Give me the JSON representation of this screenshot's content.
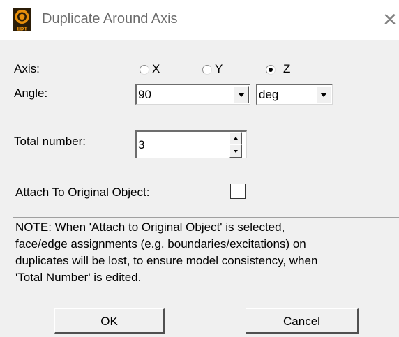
{
  "window": {
    "title": "Duplicate Around Axis",
    "close_glyph": "✕"
  },
  "axis": {
    "label": "Axis:",
    "options": [
      {
        "label": "X",
        "selected": false
      },
      {
        "label": "Y",
        "selected": false
      },
      {
        "label": "Z",
        "selected": true
      }
    ]
  },
  "angle": {
    "label": "Angle:",
    "value": "90",
    "unit": "deg"
  },
  "total_number": {
    "label": "Total number:",
    "value": "3"
  },
  "attach": {
    "label": "Attach To Original Object:",
    "checked": false
  },
  "note": {
    "lines": [
      "NOTE:  When 'Attach to Original Object' is selected,",
      "face/edge assignments (e.g. boundaries/excitations) on",
      "duplicates will be lost, to ensure model consistency, when",
      "'Total Number' is edited."
    ]
  },
  "buttons": {
    "ok": "OK",
    "cancel": "Cancel"
  },
  "icons": {
    "app": "edt-app-icon",
    "close": "close-icon"
  },
  "colors": {
    "dialog_bg": "#f0f0f0",
    "title_text": "#6b6b6b",
    "app_icon_orange": "#e8900c",
    "app_icon_dark": "#2b1d08"
  }
}
